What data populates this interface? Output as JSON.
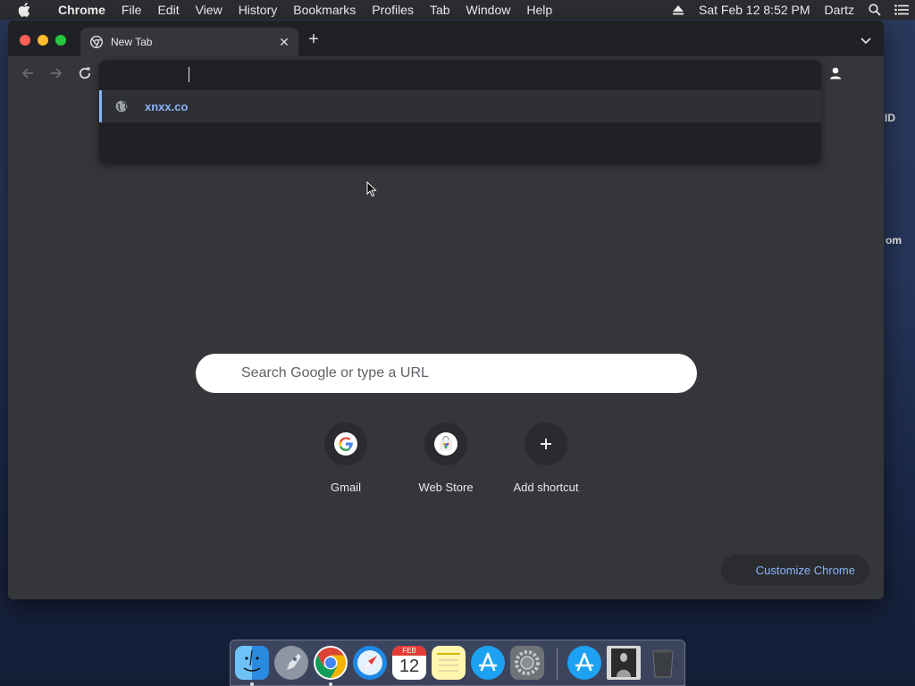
{
  "menubar": {
    "app_name": "Chrome",
    "items": [
      "File",
      "Edit",
      "View",
      "History",
      "Bookmarks",
      "Profiles",
      "Tab",
      "Window",
      "Help"
    ],
    "datetime": "Sat Feb 12  8:52 PM",
    "user": "Dartz",
    "icons": [
      "apple-icon",
      "eject-icon",
      "spotlight-search-icon",
      "notification-center-icon"
    ]
  },
  "desktop": {
    "labels": [
      "ID",
      "om"
    ]
  },
  "browser": {
    "tab": {
      "title": "New Tab",
      "favicon": "chrome-icon"
    },
    "omnibox": {
      "value": "",
      "suggestion": {
        "icon": "globe-icon",
        "text": "xnxx.co"
      }
    },
    "ntp": {
      "search_placeholder": "Search Google or type a URL",
      "shortcuts": [
        {
          "label": "Gmail",
          "icon": "google-g-icon"
        },
        {
          "label": "Web Store",
          "icon": "web-store-icon"
        },
        {
          "label": "Add shortcut",
          "icon": "plus-icon"
        }
      ],
      "customize_label": "Customize Chrome"
    }
  },
  "dock": {
    "apps": [
      "Finder",
      "Launchpad",
      "Google Chrome",
      "Safari",
      "Calendar",
      "Notes",
      "App Store",
      "System Preferences",
      "App Store",
      "Preview",
      "Trash"
    ],
    "calendar": {
      "month": "FEB",
      "day": "12"
    }
  },
  "colors": {
    "accent": "#8ab4f8",
    "window_bg": "#35363a",
    "tabstrip_bg": "#202124"
  }
}
